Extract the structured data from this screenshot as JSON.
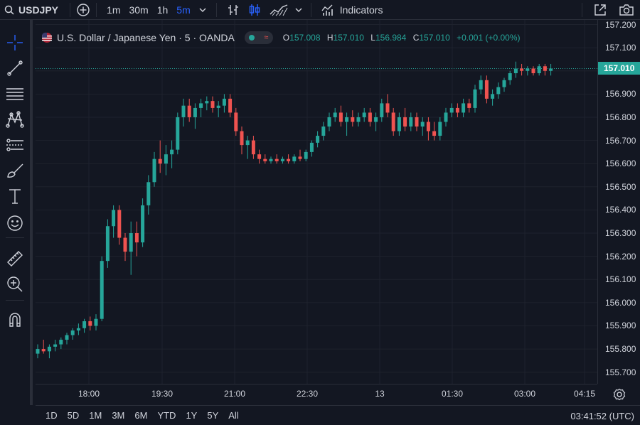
{
  "toolbar": {
    "symbol": "USDJPY",
    "timeframes": [
      "1m",
      "30m",
      "1h",
      "5m"
    ],
    "active_timeframe": "5m",
    "indicators_label": "Indicators"
  },
  "legend": {
    "title": "U.S. Dollar / Japanese Yen · 5 · OANDA",
    "o_label": "O",
    "o": "157.008",
    "h_label": "H",
    "h": "157.010",
    "l_label": "L",
    "l": "156.984",
    "c_label": "C",
    "c": "157.010",
    "change": "+0.001 (+0.00%)"
  },
  "price_axis": {
    "ticks": [
      "157.200",
      "157.100",
      "157.000",
      "156.900",
      "156.800",
      "156.700",
      "156.600",
      "156.500",
      "156.400",
      "156.300",
      "156.200",
      "156.100",
      "156.000",
      "155.900",
      "155.800",
      "155.700"
    ],
    "last_price": "157.010"
  },
  "time_axis": {
    "ticks": [
      "18:00",
      "19:30",
      "21:00",
      "22:30",
      "13",
      "01:30",
      "03:00",
      "04:15"
    ]
  },
  "bottom": {
    "ranges": [
      "1D",
      "5D",
      "1M",
      "3M",
      "6M",
      "YTD",
      "1Y",
      "5Y",
      "All"
    ],
    "clock": "03:41:52 (UTC)"
  },
  "colors": {
    "up": "#26a69a",
    "down": "#ef5350",
    "background": "#131722",
    "grid": "#1e222d",
    "accent": "#2962ff"
  },
  "chart_data": {
    "type": "candlestick",
    "ylim": [
      155.65,
      157.22
    ],
    "series": [
      {
        "values": [
          [
            155.78,
            155.82,
            155.76,
            155.8
          ],
          [
            155.8,
            155.84,
            155.78,
            155.79
          ],
          [
            155.79,
            155.82,
            155.76,
            155.81
          ],
          [
            155.81,
            155.84,
            155.79,
            155.82
          ],
          [
            155.82,
            155.85,
            155.8,
            155.84
          ],
          [
            155.84,
            155.87,
            155.82,
            155.86
          ],
          [
            155.86,
            155.89,
            155.84,
            155.88
          ],
          [
            155.88,
            155.91,
            155.86,
            155.89
          ],
          [
            155.89,
            155.93,
            155.87,
            155.92
          ],
          [
            155.92,
            155.94,
            155.88,
            155.9
          ],
          [
            155.9,
            155.95,
            155.88,
            155.93
          ],
          [
            155.93,
            156.2,
            155.92,
            156.18
          ],
          [
            156.18,
            156.36,
            156.15,
            156.33
          ],
          [
            156.33,
            156.42,
            156.28,
            156.4
          ],
          [
            156.4,
            156.42,
            156.25,
            156.28
          ],
          [
            156.28,
            156.3,
            156.18,
            156.22
          ],
          [
            156.22,
            156.35,
            156.12,
            156.3
          ],
          [
            156.3,
            156.35,
            156.2,
            156.26
          ],
          [
            156.26,
            156.45,
            156.24,
            156.42
          ],
          [
            156.42,
            156.55,
            156.38,
            156.52
          ],
          [
            156.52,
            156.65,
            156.5,
            156.62
          ],
          [
            156.62,
            156.7,
            156.56,
            156.6
          ],
          [
            156.6,
            156.68,
            156.55,
            156.64
          ],
          [
            156.64,
            156.7,
            156.58,
            156.66
          ],
          [
            156.66,
            156.82,
            156.64,
            156.8
          ],
          [
            156.8,
            156.88,
            156.76,
            156.85
          ],
          [
            156.85,
            156.88,
            156.78,
            156.8
          ],
          [
            156.8,
            156.86,
            156.75,
            156.84
          ],
          [
            156.84,
            156.88,
            156.8,
            156.86
          ],
          [
            156.86,
            156.89,
            156.83,
            156.87
          ],
          [
            156.87,
            156.89,
            156.82,
            156.84
          ],
          [
            156.84,
            156.87,
            156.8,
            156.85
          ],
          [
            156.85,
            156.9,
            156.82,
            156.88
          ],
          [
            156.88,
            156.9,
            156.8,
            156.82
          ],
          [
            156.82,
            156.84,
            156.72,
            156.74
          ],
          [
            156.74,
            156.76,
            156.64,
            156.68
          ],
          [
            156.68,
            156.72,
            156.62,
            156.7
          ],
          [
            156.7,
            156.72,
            156.62,
            156.64
          ],
          [
            156.64,
            156.66,
            156.6,
            156.62
          ],
          [
            156.62,
            156.64,
            156.6,
            156.61
          ],
          [
            156.61,
            156.63,
            156.6,
            156.62
          ],
          [
            156.62,
            156.64,
            156.6,
            156.61
          ],
          [
            156.61,
            156.63,
            156.6,
            156.62
          ],
          [
            156.62,
            156.64,
            156.6,
            156.61
          ],
          [
            156.61,
            156.64,
            156.6,
            156.63
          ],
          [
            156.63,
            156.66,
            156.61,
            156.62
          ],
          [
            156.62,
            156.66,
            156.61,
            156.65
          ],
          [
            156.65,
            156.7,
            156.63,
            156.69
          ],
          [
            156.69,
            156.74,
            156.67,
            156.72
          ],
          [
            156.72,
            156.78,
            156.7,
            156.76
          ],
          [
            156.76,
            156.82,
            156.74,
            156.8
          ],
          [
            156.8,
            156.84,
            156.78,
            156.82
          ],
          [
            156.82,
            156.85,
            156.76,
            156.78
          ],
          [
            156.78,
            156.82,
            156.72,
            156.8
          ],
          [
            156.8,
            156.83,
            156.76,
            156.78
          ],
          [
            156.78,
            156.82,
            156.76,
            156.8
          ],
          [
            156.8,
            156.84,
            156.78,
            156.82
          ],
          [
            156.82,
            156.84,
            156.76,
            156.78
          ],
          [
            156.78,
            156.82,
            156.74,
            156.8
          ],
          [
            156.8,
            156.88,
            156.78,
            156.86
          ],
          [
            156.86,
            156.9,
            156.8,
            156.82
          ],
          [
            156.82,
            156.84,
            156.72,
            156.74
          ],
          [
            156.74,
            156.82,
            156.72,
            156.8
          ],
          [
            156.8,
            156.84,
            156.74,
            156.76
          ],
          [
            156.76,
            156.82,
            156.74,
            156.8
          ],
          [
            156.8,
            156.82,
            156.74,
            156.76
          ],
          [
            156.76,
            156.8,
            156.72,
            156.78
          ],
          [
            156.78,
            156.8,
            156.7,
            156.74
          ],
          [
            156.74,
            156.78,
            156.7,
            156.72
          ],
          [
            156.72,
            156.8,
            156.7,
            156.78
          ],
          [
            156.78,
            156.84,
            156.76,
            156.82
          ],
          [
            156.82,
            156.86,
            156.8,
            156.84
          ],
          [
            156.84,
            156.86,
            156.8,
            156.82
          ],
          [
            156.82,
            156.88,
            156.8,
            156.86
          ],
          [
            156.86,
            156.88,
            156.82,
            156.84
          ],
          [
            156.84,
            156.94,
            156.82,
            156.92
          ],
          [
            156.92,
            156.98,
            156.9,
            156.96
          ],
          [
            156.96,
            156.98,
            156.86,
            156.88
          ],
          [
            156.88,
            156.92,
            156.85,
            156.9
          ],
          [
            156.9,
            156.95,
            156.88,
            156.93
          ],
          [
            156.93,
            156.97,
            156.91,
            156.96
          ],
          [
            156.96,
            157.0,
            156.94,
            156.99
          ],
          [
            156.99,
            157.04,
            156.97,
            157.01
          ],
          [
            157.01,
            157.03,
            156.98,
            157.0
          ],
          [
            157.0,
            157.02,
            156.98,
            157.01
          ],
          [
            157.01,
            157.02,
            156.98,
            156.99
          ],
          [
            156.99,
            157.03,
            156.98,
            157.02
          ],
          [
            157.02,
            157.03,
            156.98,
            157.0
          ],
          [
            157.0,
            157.03,
            156.98,
            157.01
          ]
        ]
      }
    ]
  }
}
